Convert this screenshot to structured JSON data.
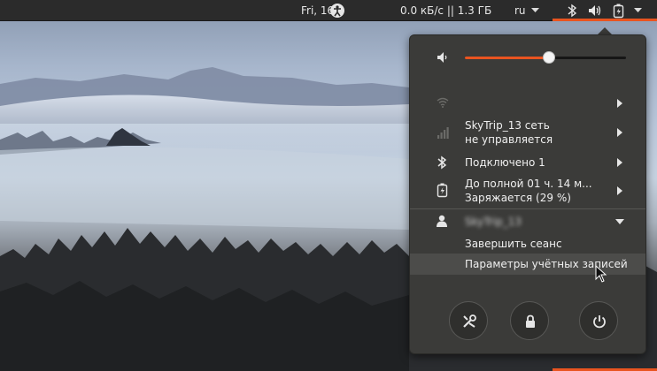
{
  "top_panel": {
    "clock": "Fri, 16:",
    "network_speed": "0.0 кБ/с || 1.3 ГБ",
    "keyboard_layout": "ru"
  },
  "colors": {
    "accent": "#e95420",
    "menu_background": "#3b3b39",
    "panel_background": "#2b2b2b"
  },
  "menu": {
    "volume": {
      "level": 0.52,
      "icon": "speaker-icon"
    },
    "wifi": {
      "label": "",
      "icon": "wifi-icon"
    },
    "wired": {
      "line1": "SkyTrip_13 сеть",
      "line2": "не управляется",
      "icon": "signal-bars-icon"
    },
    "bluetooth": {
      "label": "Подключено 1",
      "icon": "bluetooth-icon"
    },
    "battery": {
      "line1": "До полной 01 ч. 14 м...",
      "line2": "Заряжается (29 %)",
      "icon": "battery-charging-icon"
    },
    "user": {
      "name": "SkyTrip_13",
      "icon": "user-icon"
    },
    "logout_label": "Завершить сеанс",
    "account_settings_label": "Параметры учётных записей",
    "buttons": [
      "settings-icon",
      "lock-icon",
      "power-icon"
    ]
  }
}
